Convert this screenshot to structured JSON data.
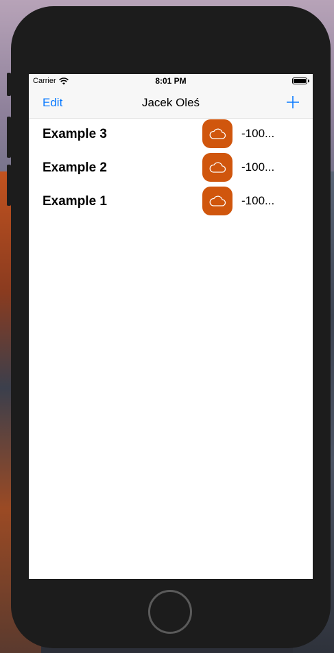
{
  "status_bar": {
    "carrier": "Carrier",
    "time": "8:01 PM"
  },
  "nav": {
    "edit_label": "Edit",
    "title": "Jacek Oleś",
    "add_icon": "plus-icon"
  },
  "items": [
    {
      "title": "Example 3",
      "icon": "cloud-icon",
      "value": "-100..."
    },
    {
      "title": "Example 2",
      "icon": "cloud-icon",
      "value": "-100..."
    },
    {
      "title": "Example 1",
      "icon": "cloud-icon",
      "value": "-100..."
    }
  ],
  "colors": {
    "accent": "#0a7aff",
    "icon_background": "#d0560d"
  }
}
